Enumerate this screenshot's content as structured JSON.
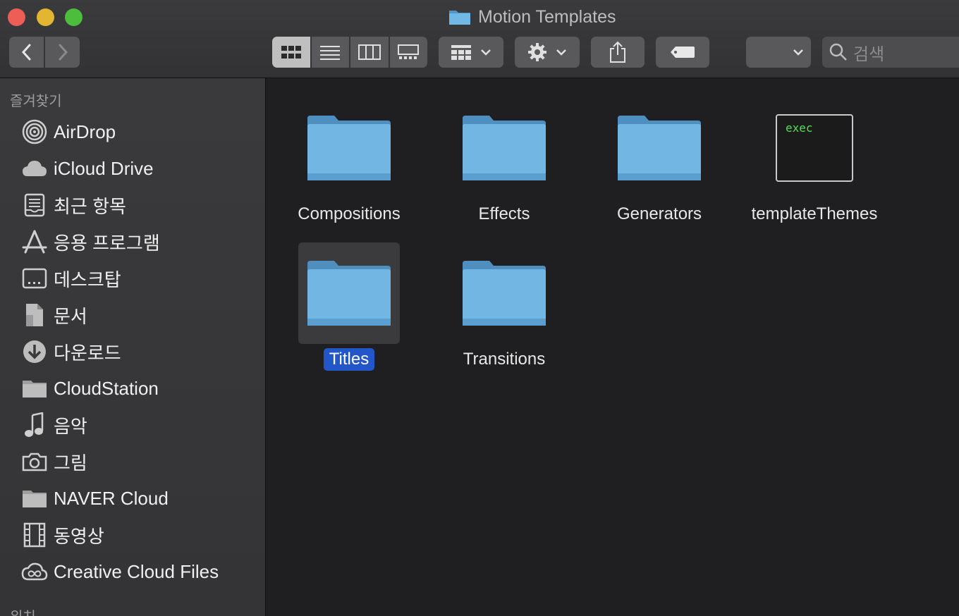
{
  "window": {
    "title": "Motion Templates",
    "traffic_lights": {
      "close": "#ee5e57",
      "minimize": "#e2b631",
      "maximize": "#4cbd3d"
    }
  },
  "toolbar": {
    "back_icon": "chevron-left-icon",
    "forward_icon": "chevron-right-icon",
    "view_modes": [
      "icon-view",
      "list-view",
      "column-view",
      "gallery-view"
    ],
    "active_view": "icon-view",
    "search_placeholder": "검색"
  },
  "sidebar": {
    "favorites_header": "즐겨찾기",
    "items": [
      {
        "label": "AirDrop",
        "icon": "airdrop-icon"
      },
      {
        "label": "iCloud Drive",
        "icon": "cloud-icon"
      },
      {
        "label": "최근 항목",
        "icon": "recents-icon"
      },
      {
        "label": "응용 프로그램",
        "icon": "applications-icon"
      },
      {
        "label": "데스크탑",
        "icon": "desktop-icon"
      },
      {
        "label": "문서",
        "icon": "document-icon"
      },
      {
        "label": "다운로드",
        "icon": "download-icon"
      },
      {
        "label": "CloudStation",
        "icon": "folder-icon"
      },
      {
        "label": "음악",
        "icon": "music-icon"
      },
      {
        "label": "그림",
        "icon": "camera-icon"
      },
      {
        "label": "NAVER Cloud",
        "icon": "folder-icon"
      },
      {
        "label": "동영상",
        "icon": "film-icon"
      },
      {
        "label": "Creative Cloud Files",
        "icon": "creative-cloud-icon"
      }
    ],
    "locations_header": "위치"
  },
  "content": {
    "items": [
      {
        "label": "Compositions",
        "type": "folder"
      },
      {
        "label": "Effects",
        "type": "folder"
      },
      {
        "label": "Generators",
        "type": "folder"
      },
      {
        "label": "templateThemes",
        "type": "exec",
        "exec_text": "exec"
      },
      {
        "label": "Titles",
        "type": "folder",
        "selected": true
      },
      {
        "label": "Transitions",
        "type": "folder"
      }
    ]
  },
  "colors": {
    "selection": "#2356c9",
    "folder": "#6bb6e6"
  }
}
